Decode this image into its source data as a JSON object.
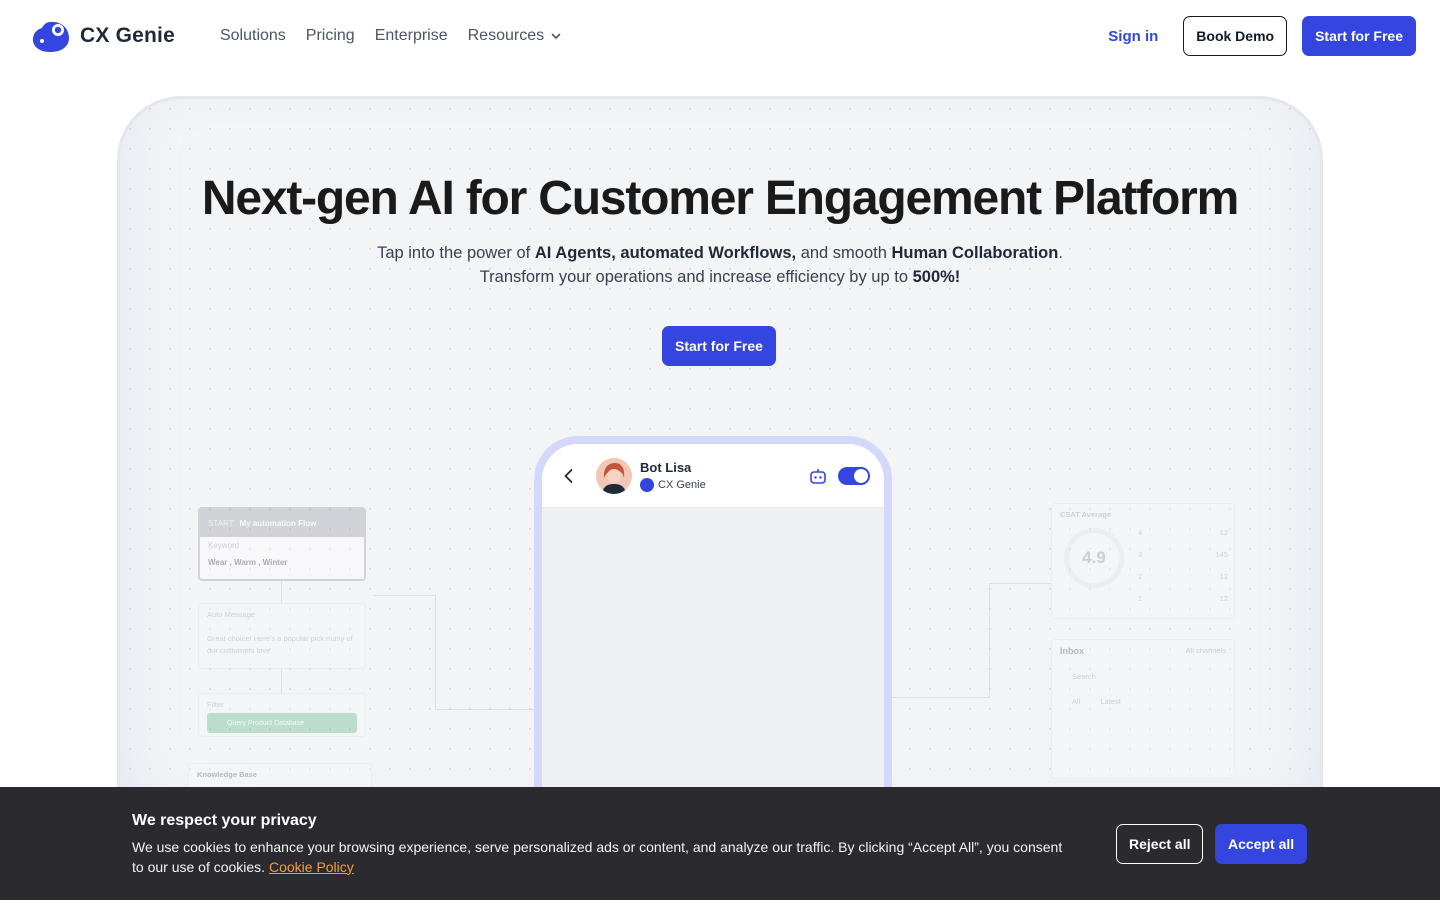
{
  "header": {
    "brand": "CX Genie",
    "nav": [
      {
        "label": "Solutions"
      },
      {
        "label": "Pricing"
      },
      {
        "label": "Enterprise"
      },
      {
        "label": "Resources"
      }
    ],
    "sign_in": "Sign in",
    "book_demo": "Book Demo",
    "start_free": "Start for Free"
  },
  "hero": {
    "title": "Next-gen AI for Customer Engagement Platform",
    "sub_1": "Tap into the power of ",
    "sub_b1": "AI Agents, automated Workflows,",
    "sub_2": " and smooth ",
    "sub_b2": "Human Collaboration",
    "sub_3": ".",
    "sub_line2": "Transform your operations and increase efficiency by up to ",
    "sub_b3": "500%!",
    "cta": "Start for Free"
  },
  "phone": {
    "bot_name": "Bot Lisa",
    "org": "CX Genie",
    "toggle_on": true
  },
  "widgets": {
    "flow_start": "START",
    "flow_title": "My automation Flow",
    "keyword_label": "Keyword",
    "keywords": "Wear , Warm , Winter",
    "auto_message_label": "Auto Message",
    "auto_message": "Great choice! Here's a popular pick many of our customers love",
    "filter_label": "Filter",
    "query_button": "Query Product Database",
    "kb_label": "Knowledge Base",
    "csat_label": "CSAT Average",
    "csat_value": "4.9",
    "csat_rows": [
      {
        "star": "4",
        "count": "12"
      },
      {
        "star": "3",
        "count": "145"
      },
      {
        "star": "2",
        "count": "12"
      },
      {
        "star": "1",
        "count": "12"
      }
    ],
    "inbox_label": "Inbox",
    "inbox_channels": "All channels",
    "inbox_search": "Search",
    "inbox_all": "All",
    "inbox_latest": "Latest"
  },
  "cookie": {
    "title": "We respect your privacy",
    "text": "We use cookies to enhance your browsing experience, serve personalized ads or content, and analyze our traffic. By clicking “Accept All”, you consent to our use of cookies. ",
    "link": "Cookie Policy",
    "reject": "Reject all",
    "accept": "Accept all"
  },
  "colors": {
    "primary": "#3445e0",
    "link": "#2f48d8",
    "cookie_bg": "#2b2b2f",
    "cookie_link": "#f59e3b"
  }
}
